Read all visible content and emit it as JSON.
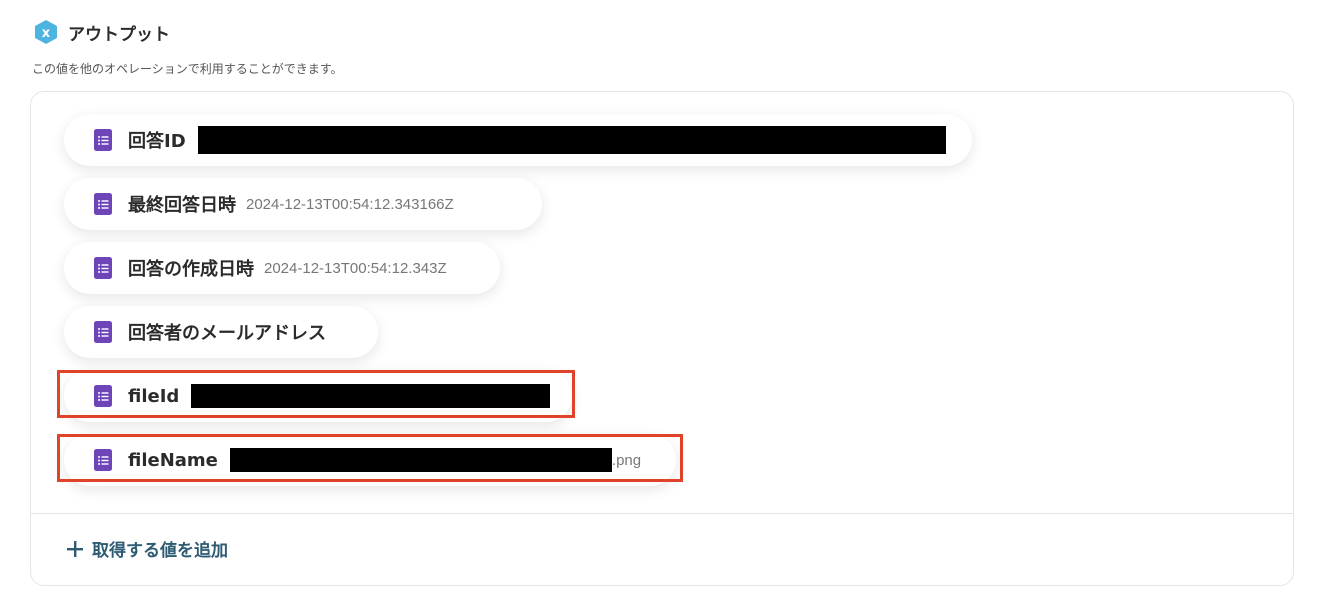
{
  "header": {
    "title": "アウトプット",
    "description": "この値を他のオペレーションで利用することができます。"
  },
  "items": [
    {
      "label": "回答ID",
      "value": "",
      "redacted": true
    },
    {
      "label": "最終回答日時",
      "value": "2024-12-13T00:54:12.343166Z"
    },
    {
      "label": "回答の作成日時",
      "value": "2024-12-13T00:54:12.343Z"
    },
    {
      "label": "回答者のメールアドレス",
      "value": ""
    },
    {
      "label": "fileId",
      "value": "",
      "redacted": true
    },
    {
      "label": "fileName",
      "value": "",
      "redacted": true,
      "suffix": ".png"
    }
  ],
  "add_button": {
    "label": "取得する値を追加"
  },
  "colors": {
    "form_icon": "#6e45b8",
    "logo": "#4db3e0",
    "highlight": "#e0422a",
    "add_accent": "#2d5b72"
  },
  "icons": {
    "logo": "yoom-logo-icon",
    "item": "google-forms-icon",
    "add": "plus-icon"
  }
}
